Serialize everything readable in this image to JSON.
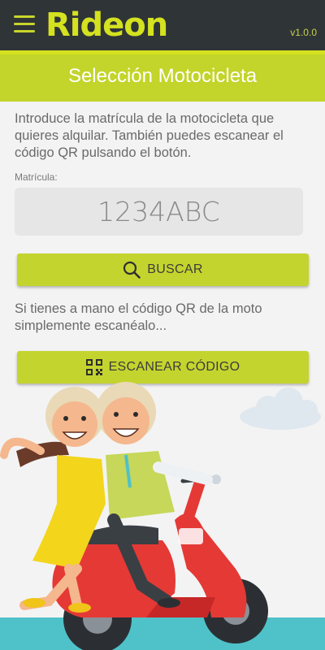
{
  "header": {
    "logo_text": "Rideon",
    "version": "v1.0.0",
    "accent_color": "#d4e21f",
    "bar_color": "#2f3437"
  },
  "page": {
    "title": "Selección Motocicleta",
    "intro": "Introduce la matrícula de la motocicleta que quieres alquilar. También puedes escanear el código QR pulsando el botón.",
    "plate_label": "Matrícula:",
    "plate_value": "1234ABC",
    "search_label": "BUSCAR",
    "hint": "Si tienes a mano el código QR de la moto simplemente escanéalo...",
    "scan_label": "ESCANEAR CÓDIGO"
  },
  "icons": {
    "menu": "hamburger-menu-icon",
    "search": "search-icon",
    "scan": "qr-code-icon"
  },
  "colors": {
    "title_bar": "#c3d42a",
    "button": "#c4d42e",
    "scooter": "#e53935"
  }
}
